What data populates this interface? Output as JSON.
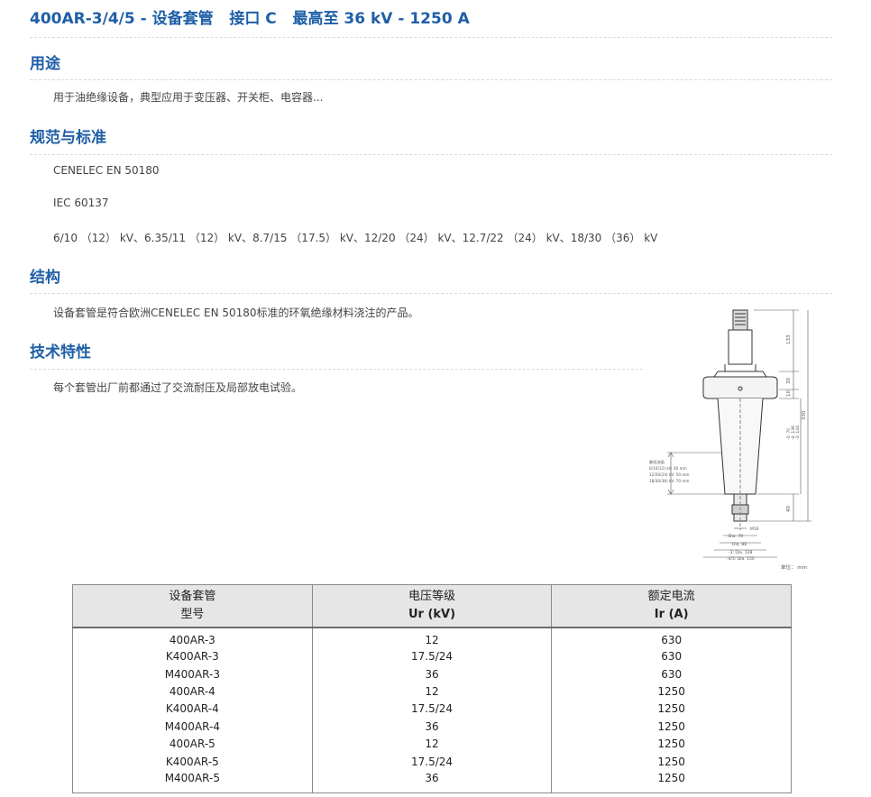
{
  "title": "400AR-3/4/5 - 设备套管   接口 C   最高至 36 kV - 1250 A",
  "sections": {
    "usage": {
      "heading": "用途",
      "text": "用于油绝缘设备，典型应用于变压器、开关柜、电容器..."
    },
    "standards": {
      "heading": "规范与标准",
      "items": [
        "CENELEC EN 50180",
        "IEC 60137",
        "6/10 （12） kV、6.35/11 （12） kV、8.7/15 （17.5） kV、12/20 （24） kV、12.7/22 （24） kV、18/30 （36） kV"
      ]
    },
    "structure": {
      "heading": "结构",
      "text": "设备套管是符合欧洲CENELEC EN 50180标准的环氧绝缘材料浇注的产品。"
    },
    "features": {
      "heading": "技术特性",
      "text": "每个套管出厂前都通过了交流耐压及局部放电试验。"
    }
  },
  "drawing": {
    "dims": [
      "133",
      "30",
      "10",
      "330",
      "-3: 144",
      "-4: 136",
      "-5: 70"
    ],
    "left_notes": [
      "最低油面",
      "6/10(12) kV: 40 mm",
      "12/20(24) kV: 50 mm",
      "18/30(36) kV: 70 mm"
    ],
    "bottom_dims": [
      "40",
      "M16",
      "Dia. 70",
      "Dia. 88",
      "-3: Dia. 128",
      "-4/5: Dia. 150"
    ],
    "unit": "单位： mm"
  },
  "table": {
    "headers": [
      {
        "line1": "设备套管",
        "line2": "型号"
      },
      {
        "line1": "电压等级",
        "line2": "Ur (kV)"
      },
      {
        "line1": "额定电流",
        "line2": "Ir (A)"
      }
    ],
    "rows": [
      [
        "400AR-3",
        "12",
        "630"
      ],
      [
        "K400AR-3",
        "17.5/24",
        "630"
      ],
      [
        "M400AR-3",
        "36",
        "630"
      ],
      [
        "400AR-4",
        "12",
        "1250"
      ],
      [
        "K400AR-4",
        "17.5/24",
        "1250"
      ],
      [
        "M400AR-4",
        "36",
        "1250"
      ],
      [
        "400AR-5",
        "12",
        "1250"
      ],
      [
        "K400AR-5",
        "17.5/24",
        "1250"
      ],
      [
        "M400AR-5",
        "36",
        "1250"
      ]
    ]
  }
}
